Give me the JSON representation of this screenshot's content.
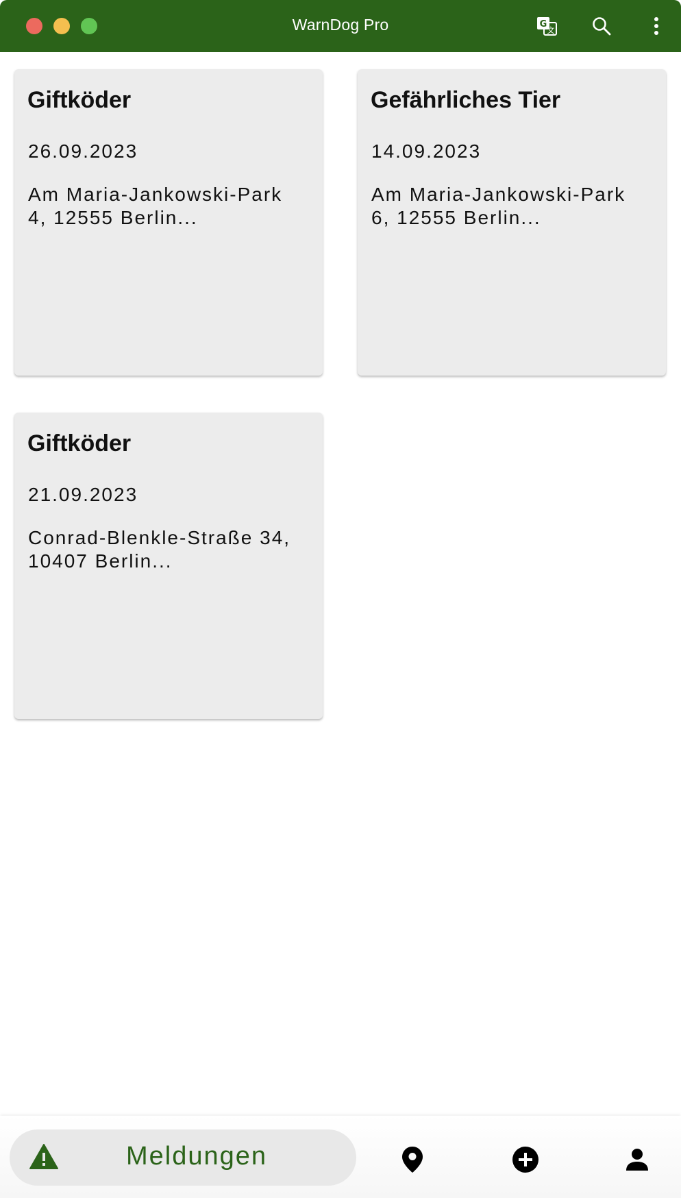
{
  "window": {
    "title": "WarnDog Pro"
  },
  "toolbar": {
    "icons": [
      "translate-icon",
      "search-icon",
      "more-vert-icon"
    ]
  },
  "reports": [
    {
      "title": "Giftköder",
      "date": "26.09.2023",
      "address": "Am Maria-Jankowski-Park 4, 12555 Berlin..."
    },
    {
      "title": "Gefährliches Tier",
      "date": "14.09.2023",
      "address": "Am Maria-Jankowski-Park 6, 12555 Berlin..."
    },
    {
      "title": "Giftköder",
      "date": "21.09.2023",
      "address": "Conrad-Blenkle-Straße 34, 10407 Berlin..."
    }
  ],
  "bottom_nav": {
    "active_label": "Meldungen",
    "items": [
      "warning-icon",
      "location-pin-icon",
      "add-circle-icon",
      "person-icon"
    ]
  },
  "colors": {
    "brand": "#2b6319",
    "card_bg": "#ececec"
  }
}
